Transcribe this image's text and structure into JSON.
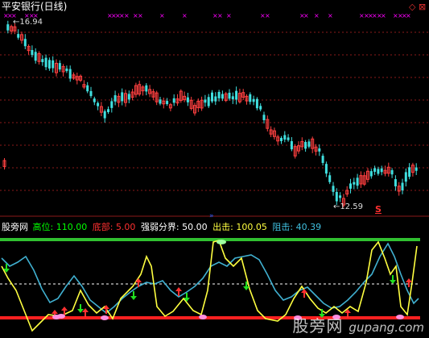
{
  "upper_panel": {
    "title": "平安银行(日线)",
    "title_color": "#ffffff",
    "high_label": "16.94",
    "low_label": "12.59",
    "signal_marker": "S",
    "signal_color": "#ff3030",
    "up_color": "#ff4040",
    "down_color": "#40e0e0",
    "magenta_marks_color": "#ff00ff"
  },
  "corner_icons": {
    "up_arrow": "◇",
    "close": "⊠"
  },
  "lower_panel": {
    "indicator_name": "股旁网",
    "items": [
      {
        "label": "高位:",
        "value": "110.00",
        "color": "#00ff00"
      },
      {
        "label": "底部:",
        "value": "5.00",
        "color": "#ff3030"
      },
      {
        "label": "强弱分界:",
        "value": "50.00",
        "color": "#ffffff"
      },
      {
        "label": "出击:",
        "value": "100.05",
        "color": "#ffff40"
      },
      {
        "label": "阻击:",
        "value": "40.39",
        "color": "#40c0e0"
      }
    ],
    "top_line_color": "#30c030",
    "bottom_line_color": "#ff2020",
    "mid_line_color": "#ffffff",
    "yellow_line_color": "#ffff40",
    "cyan_line_color": "#40b0d0"
  },
  "watermark": {
    "text_cn": "股旁网",
    "text_url": "gupang.com"
  }
}
